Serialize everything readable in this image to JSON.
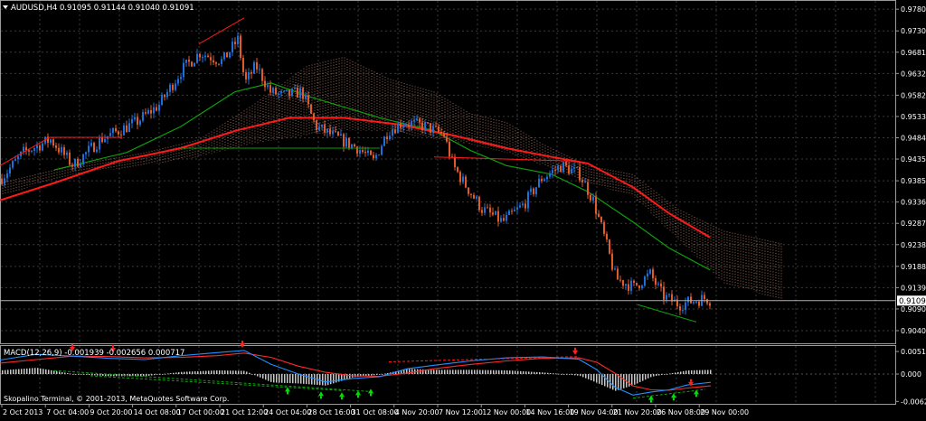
{
  "main_panel": {
    "symbol_header": "AUDUSD,H4  0.91095 0.91144 0.91040 0.91091",
    "current_price": "0.91091",
    "price_ticks": [
      "0.97800",
      "0.97300",
      "0.96810",
      "0.96320",
      "0.95820",
      "0.95330",
      "0.94840",
      "0.94350",
      "0.93850",
      "0.93360",
      "0.92870",
      "0.92380",
      "0.91880",
      "0.91390",
      "0.90900",
      "0.90400"
    ]
  },
  "macd_panel": {
    "header": "MACD(12,26,9) -0.001939 -0.002656 0.000717",
    "ticks": [
      "0.00515",
      "0.000",
      "-0.00625"
    ],
    "copyright": "Skopalino Terminal, © 2001-2013, MetaQuotes Software Corp."
  },
  "time_axis": {
    "labels": [
      "2 Oct 2013",
      "7 Oct 04:00",
      "9 Oct 20:00",
      "14 Oct 08:00",
      "17 Oct 00:00",
      "21 Oct 12:00",
      "24 Oct 04:00",
      "28 Oct 16:00",
      "31 Oct 08:00",
      "4 Nov 20:00",
      "7 Nov 12:00",
      "12 Nov 00:00",
      "14 Nov 16:00",
      "19 Nov 04:00",
      "21 Nov 20:00",
      "26 Nov 08:00",
      "29 Nov 00:00"
    ]
  },
  "colors": {
    "background": "#000000",
    "grid": "#3a3a3a",
    "text": "#ffffff",
    "candle_bull": "#1e6fd9",
    "candle_bear": "#e05a2a",
    "ma_fast": "#ff1a1a",
    "ma_slow": "#0da00d",
    "cloud_up": "#e0a080",
    "cloud_down": "#e6e6e6",
    "macd_line": "#1e90ff",
    "signal_line": "#ff2a2a",
    "histogram": "#c8c8c8",
    "arrow_up": "#00e000",
    "arrow_down": "#ff2020"
  },
  "chart_data": {
    "type": "candlestick",
    "symbol": "AUDUSD",
    "timeframe": "H4",
    "price_range": [
      0.9015,
      0.9797
    ],
    "macd_range": [
      -0.0066,
      0.0062
    ],
    "grid": true,
    "anchors": [
      [
        0,
        0.939
      ],
      [
        25,
        0.945
      ],
      [
        55,
        0.948
      ],
      [
        80,
        0.942
      ],
      [
        110,
        0.948
      ],
      [
        150,
        0.952
      ],
      [
        175,
        0.956
      ],
      [
        200,
        0.964
      ],
      [
        220,
        0.968
      ],
      [
        245,
        0.966
      ],
      [
        262,
        0.971
      ],
      [
        270,
        0.961
      ],
      [
        282,
        0.965
      ],
      [
        298,
        0.959
      ],
      [
        312,
        0.958
      ],
      [
        333,
        0.959
      ],
      [
        348,
        0.951
      ],
      [
        375,
        0.948
      ],
      [
        395,
        0.946
      ],
      [
        412,
        0.943
      ],
      [
        428,
        0.95
      ],
      [
        445,
        0.952
      ],
      [
        470,
        0.951
      ],
      [
        490,
        0.949
      ],
      [
        500,
        0.942
      ],
      [
        512,
        0.938
      ],
      [
        532,
        0.932
      ],
      [
        555,
        0.929
      ],
      [
        578,
        0.933
      ],
      [
        598,
        0.939
      ],
      [
        620,
        0.942
      ],
      [
        640,
        0.94
      ],
      [
        655,
        0.934
      ],
      [
        668,
        0.925
      ],
      [
        680,
        0.916
      ],
      [
        700,
        0.914
      ],
      [
        718,
        0.917
      ],
      [
        732,
        0.912
      ],
      [
        750,
        0.91
      ],
      [
        768,
        0.911
      ],
      [
        780,
        0.9115
      ],
      [
        786,
        0.9109
      ]
    ],
    "ma_fast": [
      [
        0,
        0.934
      ],
      [
        60,
        0.938
      ],
      [
        130,
        0.943
      ],
      [
        200,
        0.946
      ],
      [
        260,
        0.95
      ],
      [
        320,
        0.953
      ],
      [
        380,
        0.953
      ],
      [
        440,
        0.9515
      ],
      [
        500,
        0.949
      ],
      [
        560,
        0.946
      ],
      [
        610,
        0.944
      ],
      [
        650,
        0.9425
      ],
      [
        700,
        0.937
      ],
      [
        740,
        0.931
      ],
      [
        785,
        0.9255
      ]
    ],
    "ma_slow": [
      [
        60,
        0.941
      ],
      [
        140,
        0.945
      ],
      [
        200,
        0.951
      ],
      [
        260,
        0.959
      ],
      [
        300,
        0.961
      ],
      [
        340,
        0.958
      ],
      [
        420,
        0.953
      ],
      [
        480,
        0.95
      ],
      [
        520,
        0.9455
      ],
      [
        560,
        0.942
      ],
      [
        610,
        0.94
      ],
      [
        650,
        0.936
      ],
      [
        700,
        0.929
      ],
      [
        740,
        0.923
      ],
      [
        785,
        0.918
      ]
    ],
    "cloud_a": [
      [
        0,
        0.938
      ],
      [
        80,
        0.942
      ],
      [
        160,
        0.945
      ],
      [
        220,
        0.948
      ],
      [
        280,
        0.956
      ],
      [
        340,
        0.965
      ],
      [
        380,
        0.967
      ],
      [
        430,
        0.962
      ],
      [
        480,
        0.959
      ],
      [
        520,
        0.954
      ],
      [
        560,
        0.952
      ],
      [
        600,
        0.947
      ],
      [
        650,
        0.942
      ],
      [
        700,
        0.94
      ],
      [
        750,
        0.932
      ],
      [
        800,
        0.927
      ],
      [
        866,
        0.924
      ]
    ],
    "cloud_b": [
      [
        0,
        0.935
      ],
      [
        80,
        0.94
      ],
      [
        160,
        0.942
      ],
      [
        220,
        0.944
      ],
      [
        280,
        0.947
      ],
      [
        340,
        0.949
      ],
      [
        380,
        0.95
      ],
      [
        430,
        0.95
      ],
      [
        480,
        0.948
      ],
      [
        520,
        0.947
      ],
      [
        560,
        0.945
      ],
      [
        600,
        0.942
      ],
      [
        650,
        0.938
      ],
      [
        700,
        0.935
      ],
      [
        750,
        0.925
      ],
      [
        800,
        0.915
      ],
      [
        866,
        0.911
      ]
    ],
    "trend_lines": [
      {
        "points": [
          [
            0,
            0.942
          ],
          [
            55,
            0.9485
          ],
          [
            135,
            0.9485
          ]
        ],
        "color": "#ff1a1a"
      },
      {
        "points": [
          [
            220,
            0.97
          ],
          [
            270,
            0.976
          ]
        ],
        "color": "#ff1a1a"
      },
      {
        "points": [
          [
            200,
            0.946
          ],
          [
            420,
            0.946
          ]
        ],
        "color": "#0da00d"
      },
      {
        "points": [
          [
            480,
            0.944
          ],
          [
            640,
            0.943
          ]
        ],
        "color": "#ff1a1a"
      },
      {
        "points": [
          [
            705,
            0.91
          ],
          [
            770,
            0.906
          ]
        ],
        "color": "#0da00d"
      }
    ],
    "macd": [
      [
        0,
        0.0032
      ],
      [
        40,
        0.0045
      ],
      [
        80,
        0.0041
      ],
      [
        120,
        0.0036
      ],
      [
        160,
        0.0033
      ],
      [
        200,
        0.0042
      ],
      [
        240,
        0.0049
      ],
      [
        270,
        0.0054
      ],
      [
        300,
        0.0022
      ],
      [
        330,
        0.0
      ],
      [
        360,
        -0.0018
      ],
      [
        390,
        -0.001
      ],
      [
        420,
        -0.0006
      ],
      [
        450,
        0.0012
      ],
      [
        480,
        0.002
      ],
      [
        520,
        0.003
      ],
      [
        560,
        0.0037
      ],
      [
        600,
        0.0039
      ],
      [
        640,
        0.0034
      ],
      [
        660,
        0.001
      ],
      [
        680,
        -0.003
      ],
      [
        700,
        -0.0048
      ],
      [
        720,
        -0.0041
      ],
      [
        740,
        -0.0036
      ],
      [
        760,
        -0.0025
      ],
      [
        786,
        -0.0019
      ]
    ],
    "signal": [
      [
        0,
        0.0025
      ],
      [
        40,
        0.0033
      ],
      [
        80,
        0.0041
      ],
      [
        120,
        0.004
      ],
      [
        160,
        0.0037
      ],
      [
        200,
        0.0038
      ],
      [
        240,
        0.0042
      ],
      [
        270,
        0.0048
      ],
      [
        300,
        0.0038
      ],
      [
        330,
        0.0018
      ],
      [
        360,
        0.0004
      ],
      [
        390,
        -0.0004
      ],
      [
        420,
        -0.0005
      ],
      [
        450,
        0.0002
      ],
      [
        480,
        0.0012
      ],
      [
        520,
        0.0022
      ],
      [
        560,
        0.003
      ],
      [
        600,
        0.0036
      ],
      [
        640,
        0.0037
      ],
      [
        660,
        0.0027
      ],
      [
        680,
        0.0002
      ],
      [
        700,
        -0.0027
      ],
      [
        720,
        -0.0036
      ],
      [
        740,
        -0.0037
      ],
      [
        760,
        -0.0032
      ],
      [
        786,
        -0.0027
      ]
    ],
    "macd_trend_lines": [
      {
        "points": [
          [
            60,
            0.0008
          ],
          [
            410,
            -0.004
          ]
        ],
        "color": "#0da00d"
      },
      {
        "points": [
          [
            100,
            -0.0004
          ],
          [
            380,
            -0.0038
          ]
        ],
        "color": "#0da00d"
      },
      {
        "points": [
          [
            430,
            0.0028
          ],
          [
            640,
            0.004
          ]
        ],
        "color": "#ff1a1a"
      },
      {
        "points": [
          [
            700,
            -0.0055
          ],
          [
            780,
            -0.0035
          ]
        ],
        "color": "#0da00d"
      }
    ],
    "arrows_up": [
      [
        318,
        -0.0038
      ],
      [
        355,
        -0.0048
      ],
      [
        378,
        -0.005
      ],
      [
        396,
        -0.0046
      ],
      [
        410,
        -0.0042
      ],
      [
        720,
        -0.0057
      ],
      [
        745,
        -0.0052
      ],
      [
        770,
        -0.0044
      ]
    ],
    "arrows_down": [
      [
        80,
        0.006
      ],
      [
        125,
        0.0058
      ],
      [
        268,
        0.0068
      ],
      [
        636,
        0.0052
      ],
      [
        764,
        -0.002
      ]
    ]
  }
}
